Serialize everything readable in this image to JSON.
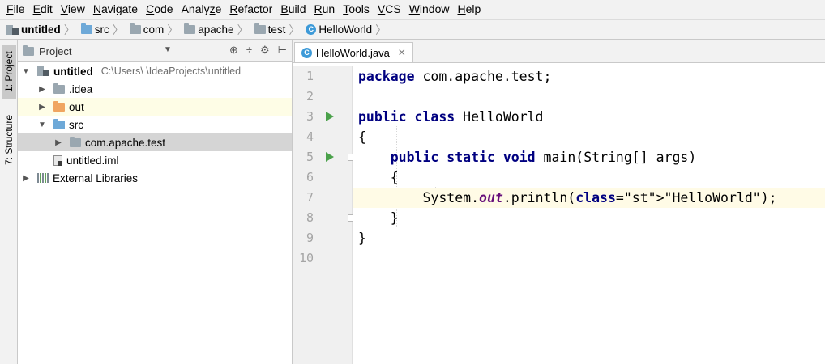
{
  "menu": [
    "File",
    "Edit",
    "View",
    "Navigate",
    "Code",
    "Analyze",
    "Refactor",
    "Build",
    "Run",
    "Tools",
    "VCS",
    "Window",
    "Help"
  ],
  "menu_mnemonics": [
    0,
    0,
    0,
    0,
    0,
    5,
    0,
    0,
    0,
    0,
    0,
    0,
    0
  ],
  "breadcrumb": [
    {
      "label": "untitled",
      "icon": "project-icon",
      "bold": true
    },
    {
      "label": "src",
      "icon": "folder-blue-icon"
    },
    {
      "label": "com",
      "icon": "folder-icon"
    },
    {
      "label": "apache",
      "icon": "folder-icon"
    },
    {
      "label": "test",
      "icon": "folder-icon"
    },
    {
      "label": "HelloWorld",
      "icon": "class-icon"
    }
  ],
  "tool_strip": {
    "project_tab": "1: Project",
    "structure_tab": "7: Structure"
  },
  "project_panel": {
    "title": "Project",
    "tree": [
      {
        "label": "untitled",
        "path": "C:\\Users\\    \\IdeaProjects\\untitled",
        "bold": true,
        "icon": "project-icon",
        "depth": 0,
        "arrow": "down"
      },
      {
        "label": ".idea",
        "icon": "folder-icon",
        "depth": 1,
        "arrow": "right"
      },
      {
        "label": "out",
        "icon": "folder-orange-icon",
        "depth": 1,
        "arrow": "right",
        "highlight": "yellow"
      },
      {
        "label": "src",
        "icon": "folder-blue-icon",
        "depth": 1,
        "arrow": "down"
      },
      {
        "label": "com.apache.test",
        "icon": "package-icon",
        "depth": 2,
        "arrow": "right",
        "highlight": "grey"
      },
      {
        "label": "untitled.iml",
        "icon": "module-file-icon",
        "depth": 1,
        "arrow": ""
      },
      {
        "label": "External Libraries",
        "icon": "libraries-icon",
        "depth": 0,
        "arrow": "right"
      }
    ]
  },
  "editor": {
    "tab_label": "HelloWorld.java",
    "current_line": 7,
    "lines": [
      {
        "n": "1",
        "text": "package com.apache.test;"
      },
      {
        "n": "2",
        "text": ""
      },
      {
        "n": "3",
        "text": "public class HelloWorld",
        "run": true
      },
      {
        "n": "4",
        "text": "{"
      },
      {
        "n": "5",
        "text": "    public static void main(String[] args)",
        "run": true,
        "fold": true
      },
      {
        "n": "6",
        "text": "    {"
      },
      {
        "n": "7",
        "text": "        System.out.println(\"HelloWorld\");"
      },
      {
        "n": "8",
        "text": "    }",
        "fold": true
      },
      {
        "n": "9",
        "text": "}"
      },
      {
        "n": "10",
        "text": ""
      }
    ]
  },
  "colors": {
    "keyword": "#000080",
    "string": "#008000",
    "static_field": "#660e7a",
    "current_line": "#fffbe6",
    "run_arrow": "#4aa14a"
  }
}
